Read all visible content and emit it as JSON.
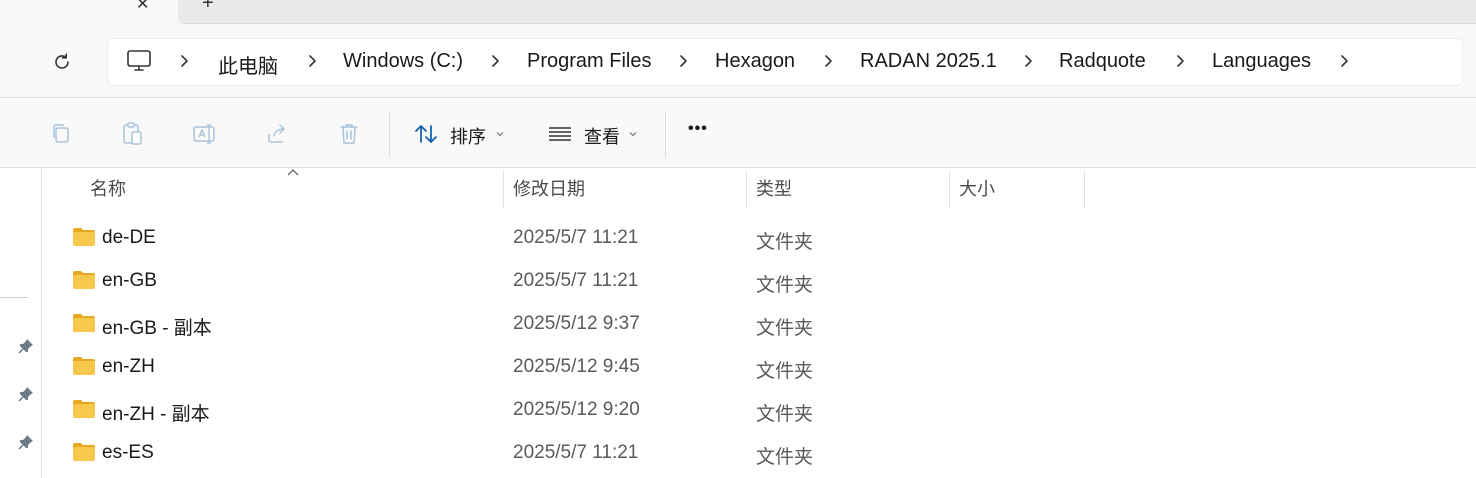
{
  "tabs": {
    "close_glyph": "✕",
    "new_tab_glyph": "+"
  },
  "address_bar": {
    "refresh_icon": "refresh-icon",
    "root_icon": "computer-icon",
    "crumbs": [
      "此电脑",
      "Windows (C:)",
      "Program Files",
      "Hexagon",
      "RADAN 2025.1",
      "Radquote",
      "Languages"
    ]
  },
  "command_bar": {
    "icons": [
      "copy-icon",
      "paste-icon",
      "rename-icon",
      "share-icon",
      "delete-icon"
    ],
    "sort_label": "排序",
    "view_label": "查看",
    "more_glyph": "•••"
  },
  "columns": {
    "name": "名称",
    "modified": "修改日期",
    "type": "类型",
    "size": "大小"
  },
  "files": [
    {
      "name": "de-DE",
      "modified": "2025/5/7 11:21",
      "type": "文件夹",
      "size": ""
    },
    {
      "name": "en-GB",
      "modified": "2025/5/7 11:21",
      "type": "文件夹",
      "size": ""
    },
    {
      "name": "en-GB - 副本",
      "modified": "2025/5/12 9:37",
      "type": "文件夹",
      "size": ""
    },
    {
      "name": "en-ZH",
      "modified": "2025/5/12 9:45",
      "type": "文件夹",
      "size": ""
    },
    {
      "name": "en-ZH - 副本",
      "modified": "2025/5/12 9:20",
      "type": "文件夹",
      "size": ""
    },
    {
      "name": "es-ES",
      "modified": "2025/5/7 11:21",
      "type": "文件夹",
      "size": ""
    }
  ],
  "colors": {
    "folder_yellow": "#f8c84c",
    "folder_dark": "#e8a823",
    "accent": "#0067c0"
  }
}
